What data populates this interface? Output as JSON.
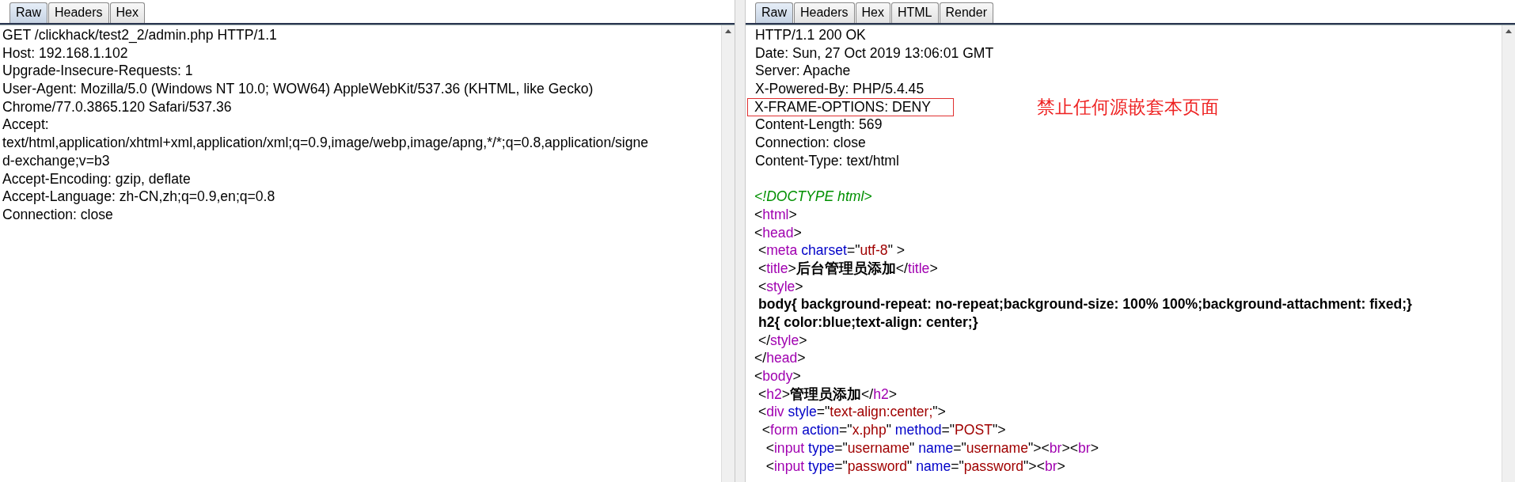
{
  "request": {
    "tabs": [
      {
        "label": "Raw",
        "selected": true
      },
      {
        "label": "Headers",
        "selected": false
      },
      {
        "label": "Hex",
        "selected": false
      }
    ],
    "lines": [
      "GET /clickhack/test2_2/admin.php HTTP/1.1",
      "Host: 192.168.1.102",
      "Upgrade-Insecure-Requests: 1",
      "User-Agent: Mozilla/5.0 (Windows NT 10.0; WOW64) AppleWebKit/537.36 (KHTML, like Gecko)",
      "Chrome/77.0.3865.120 Safari/537.36",
      "Accept:",
      "text/html,application/xhtml+xml,application/xml;q=0.9,image/webp,image/apng,*/*;q=0.8,application/signe",
      "d-exchange;v=b3",
      "Accept-Encoding: gzip, deflate",
      "Accept-Language: zh-CN,zh;q=0.9,en;q=0.8",
      "Connection: close"
    ]
  },
  "response": {
    "tabs": [
      {
        "label": "Raw",
        "selected": true
      },
      {
        "label": "Headers",
        "selected": false
      },
      {
        "label": "Hex",
        "selected": false
      },
      {
        "label": "HTML",
        "selected": false
      },
      {
        "label": "Render",
        "selected": false
      }
    ],
    "headers": [
      {
        "text": "HTTP/1.1 200 OK",
        "highlighted": false
      },
      {
        "text": "Date: Sun, 27 Oct 2019 13:06:01 GMT",
        "highlighted": false
      },
      {
        "text": "Server: Apache",
        "highlighted": false
      },
      {
        "text": "X-Powered-By: PHP/5.4.45",
        "highlighted": false
      },
      {
        "text": "X-FRAME-OPTIONS: DENY",
        "highlighted": true
      },
      {
        "text": "Content-Length: 569",
        "highlighted": false
      },
      {
        "text": "Connection: close",
        "highlighted": false
      },
      {
        "text": "Content-Type: text/html",
        "highlighted": false
      }
    ],
    "annotation": "禁止任何源嵌套本页面",
    "code": [
      [
        {
          "kind": "doctype",
          "text": "<!DOCTYPE html>"
        }
      ],
      [
        {
          "kind": "punct",
          "text": "<"
        },
        {
          "kind": "tag",
          "text": "html"
        },
        {
          "kind": "punct",
          "text": ">"
        }
      ],
      [
        {
          "kind": "punct",
          "text": "<"
        },
        {
          "kind": "tag",
          "text": "head"
        },
        {
          "kind": "punct",
          "text": ">"
        }
      ],
      [
        {
          "kind": "punct",
          "text": " <"
        },
        {
          "kind": "tag",
          "text": "meta"
        },
        {
          "kind": "attr",
          "text": " charset"
        },
        {
          "kind": "punct",
          "text": "=\""
        },
        {
          "kind": "value",
          "text": "utf-8"
        },
        {
          "kind": "punct",
          "text": "\" >"
        }
      ],
      [
        {
          "kind": "punct",
          "text": " <"
        },
        {
          "kind": "tag",
          "text": "title"
        },
        {
          "kind": "punct",
          "text": ">"
        },
        {
          "kind": "text",
          "text": "后台管理员添加"
        },
        {
          "kind": "punct",
          "text": "</"
        },
        {
          "kind": "tag",
          "text": "title"
        },
        {
          "kind": "punct",
          "text": ">"
        }
      ],
      [
        {
          "kind": "punct",
          "text": " <"
        },
        {
          "kind": "tag",
          "text": "style"
        },
        {
          "kind": "punct",
          "text": ">"
        }
      ],
      [
        {
          "kind": "text",
          "text": " body{ background-repeat: no-repeat;background-size: 100% 100%;background-attachment: fixed;}"
        }
      ],
      [
        {
          "kind": "text",
          "text": " h2{ color:blue;text-align: center;}"
        }
      ],
      [
        {
          "kind": "punct",
          "text": " </"
        },
        {
          "kind": "tag",
          "text": "style"
        },
        {
          "kind": "punct",
          "text": ">"
        }
      ],
      [
        {
          "kind": "punct",
          "text": "</"
        },
        {
          "kind": "tag",
          "text": "head"
        },
        {
          "kind": "punct",
          "text": ">"
        }
      ],
      [
        {
          "kind": "punct",
          "text": "<"
        },
        {
          "kind": "tag",
          "text": "body"
        },
        {
          "kind": "punct",
          "text": ">"
        }
      ],
      [
        {
          "kind": "punct",
          "text": " <"
        },
        {
          "kind": "tag",
          "text": "h2"
        },
        {
          "kind": "punct",
          "text": ">"
        },
        {
          "kind": "text",
          "text": "管理员添加"
        },
        {
          "kind": "punct",
          "text": "</"
        },
        {
          "kind": "tag",
          "text": "h2"
        },
        {
          "kind": "punct",
          "text": ">"
        }
      ],
      [
        {
          "kind": "punct",
          "text": " <"
        },
        {
          "kind": "tag",
          "text": "div"
        },
        {
          "kind": "attr",
          "text": " style"
        },
        {
          "kind": "punct",
          "text": "=\""
        },
        {
          "kind": "value",
          "text": "text-align:center;"
        },
        {
          "kind": "punct",
          "text": "\">"
        }
      ],
      [
        {
          "kind": "punct",
          "text": "  <"
        },
        {
          "kind": "tag",
          "text": "form"
        },
        {
          "kind": "attr",
          "text": " action"
        },
        {
          "kind": "punct",
          "text": "=\""
        },
        {
          "kind": "value",
          "text": "x.php"
        },
        {
          "kind": "punct",
          "text": "\""
        },
        {
          "kind": "attr",
          "text": " method"
        },
        {
          "kind": "punct",
          "text": "=\""
        },
        {
          "kind": "value",
          "text": "POST"
        },
        {
          "kind": "punct",
          "text": "\">"
        }
      ],
      [
        {
          "kind": "punct",
          "text": "   <"
        },
        {
          "kind": "tag",
          "text": "input"
        },
        {
          "kind": "attr",
          "text": " type"
        },
        {
          "kind": "punct",
          "text": "=\""
        },
        {
          "kind": "value",
          "text": "username"
        },
        {
          "kind": "punct",
          "text": "\""
        },
        {
          "kind": "attr",
          "text": " name"
        },
        {
          "kind": "punct",
          "text": "=\""
        },
        {
          "kind": "value",
          "text": "username"
        },
        {
          "kind": "punct",
          "text": "\"><"
        },
        {
          "kind": "tag",
          "text": "br"
        },
        {
          "kind": "punct",
          "text": "><"
        },
        {
          "kind": "tag",
          "text": "br"
        },
        {
          "kind": "punct",
          "text": ">"
        }
      ],
      [
        {
          "kind": "punct",
          "text": "   <"
        },
        {
          "kind": "tag",
          "text": "input"
        },
        {
          "kind": "attr",
          "text": " type"
        },
        {
          "kind": "punct",
          "text": "=\""
        },
        {
          "kind": "value",
          "text": "password"
        },
        {
          "kind": "punct",
          "text": "\""
        },
        {
          "kind": "attr",
          "text": " name"
        },
        {
          "kind": "punct",
          "text": "=\""
        },
        {
          "kind": "value",
          "text": "password"
        },
        {
          "kind": "punct",
          "text": "\"><"
        },
        {
          "kind": "tag",
          "text": "br"
        },
        {
          "kind": "punct",
          "text": ">"
        }
      ]
    ]
  }
}
